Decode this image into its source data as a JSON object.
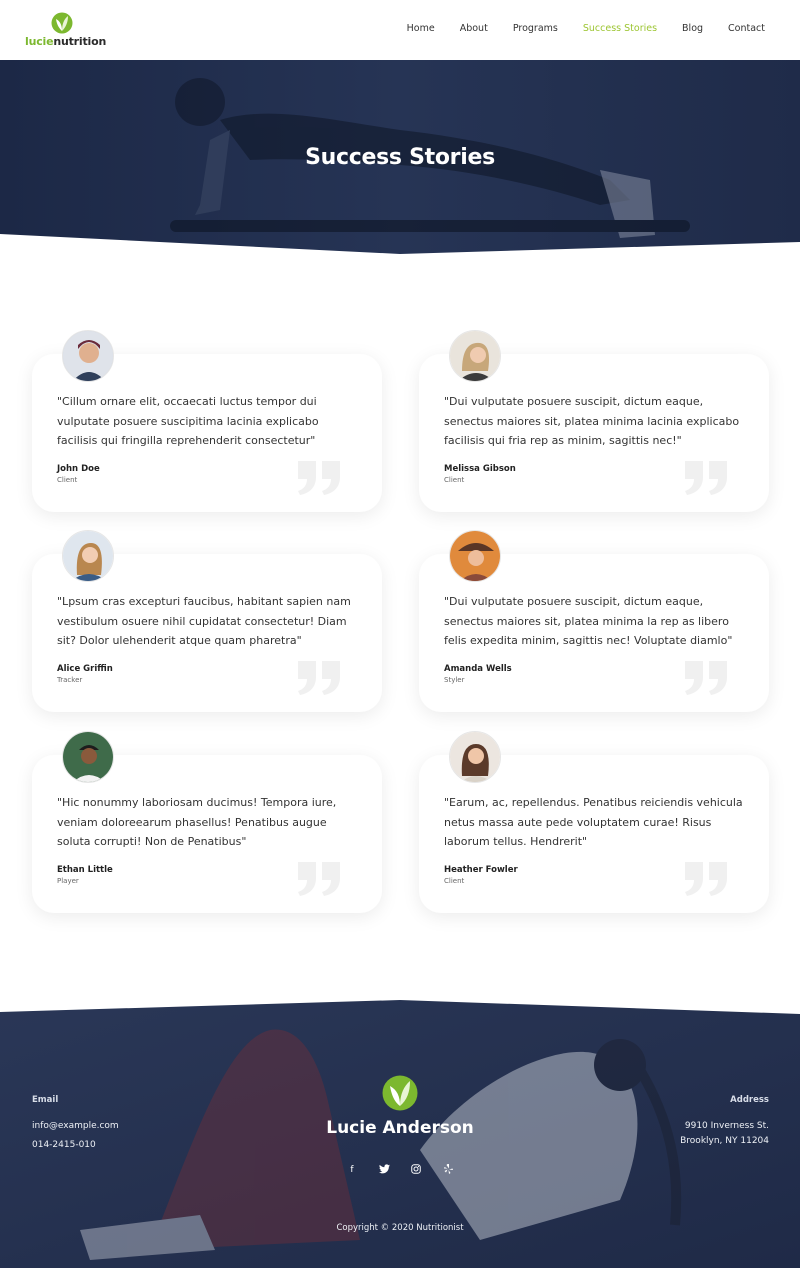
{
  "brand": {
    "part1": "lucie",
    "part2": "nutrition"
  },
  "nav": {
    "items": [
      {
        "label": "Home"
      },
      {
        "label": "About"
      },
      {
        "label": "Programs"
      },
      {
        "label": "Success Stories"
      },
      {
        "label": "Blog"
      },
      {
        "label": "Contact"
      }
    ],
    "active_index": 3
  },
  "hero": {
    "title": "Success Stories"
  },
  "testimonials": [
    {
      "quote": "\"Cillum ornare elit, occaecati luctus tempor dui vulputate posuere suscipitima lacinia explicabo facilisis qui fringilla reprehenderit consectetur\"",
      "name": "John Doe",
      "role": "Client"
    },
    {
      "quote": "\"Dui vulputate posuere suscipit, dictum eaque, senectus maiores sit, platea minima lacinia explicabo facilisis qui fria rep as minim, sagittis nec!\"",
      "name": "Melissa Gibson",
      "role": "Client"
    },
    {
      "quote": "\"Lpsum cras excepturi faucibus, habitant sapien nam vestibulum osuere nihil cupidatat consectetur! Diam sit? Dolor ulehenderit atque quam pharetra\"",
      "name": "Alice Griffin",
      "role": "Tracker"
    },
    {
      "quote": "\"Dui vulputate posuere suscipit, dictum eaque, senectus maiores sit, platea minima la rep as libero felis expedita minim, sagittis nec! Voluptate diamlo\"",
      "name": "Amanda Wells",
      "role": "Styler"
    },
    {
      "quote": "\"Hic nonummy laboriosam ducimus! Tempora iure, veniam doloreearum phasellus! Penatibus augue soluta corrupti! Non de Penatibus\"",
      "name": "Ethan Little",
      "role": "Player"
    },
    {
      "quote": "\"Earum, ac, repellendus. Penatibus reiciendis vehicula netus massa aute pede voluptatem curae! Risus laborum tellus. Hendrerit\"",
      "name": "Heather Fowler",
      "role": "Client"
    }
  ],
  "footer": {
    "email_label": "Email",
    "email": "info@example.com",
    "phone": "014-2415-010",
    "name": "Lucie Anderson",
    "address_label": "Address",
    "address_line1": "9910 Inverness St.",
    "address_line2": "Brooklyn, NY 11204",
    "social_icons": [
      "facebook-icon",
      "twitter-icon",
      "instagram-icon",
      "yelp-icon"
    ],
    "copyright": "Copyright © 2020 Nutritionist"
  },
  "colors": {
    "accent_green": "#7cb82f",
    "nav_active": "#9cc531",
    "hero_overlay": "#1e2a48",
    "footer_overlay": "#23304f"
  }
}
